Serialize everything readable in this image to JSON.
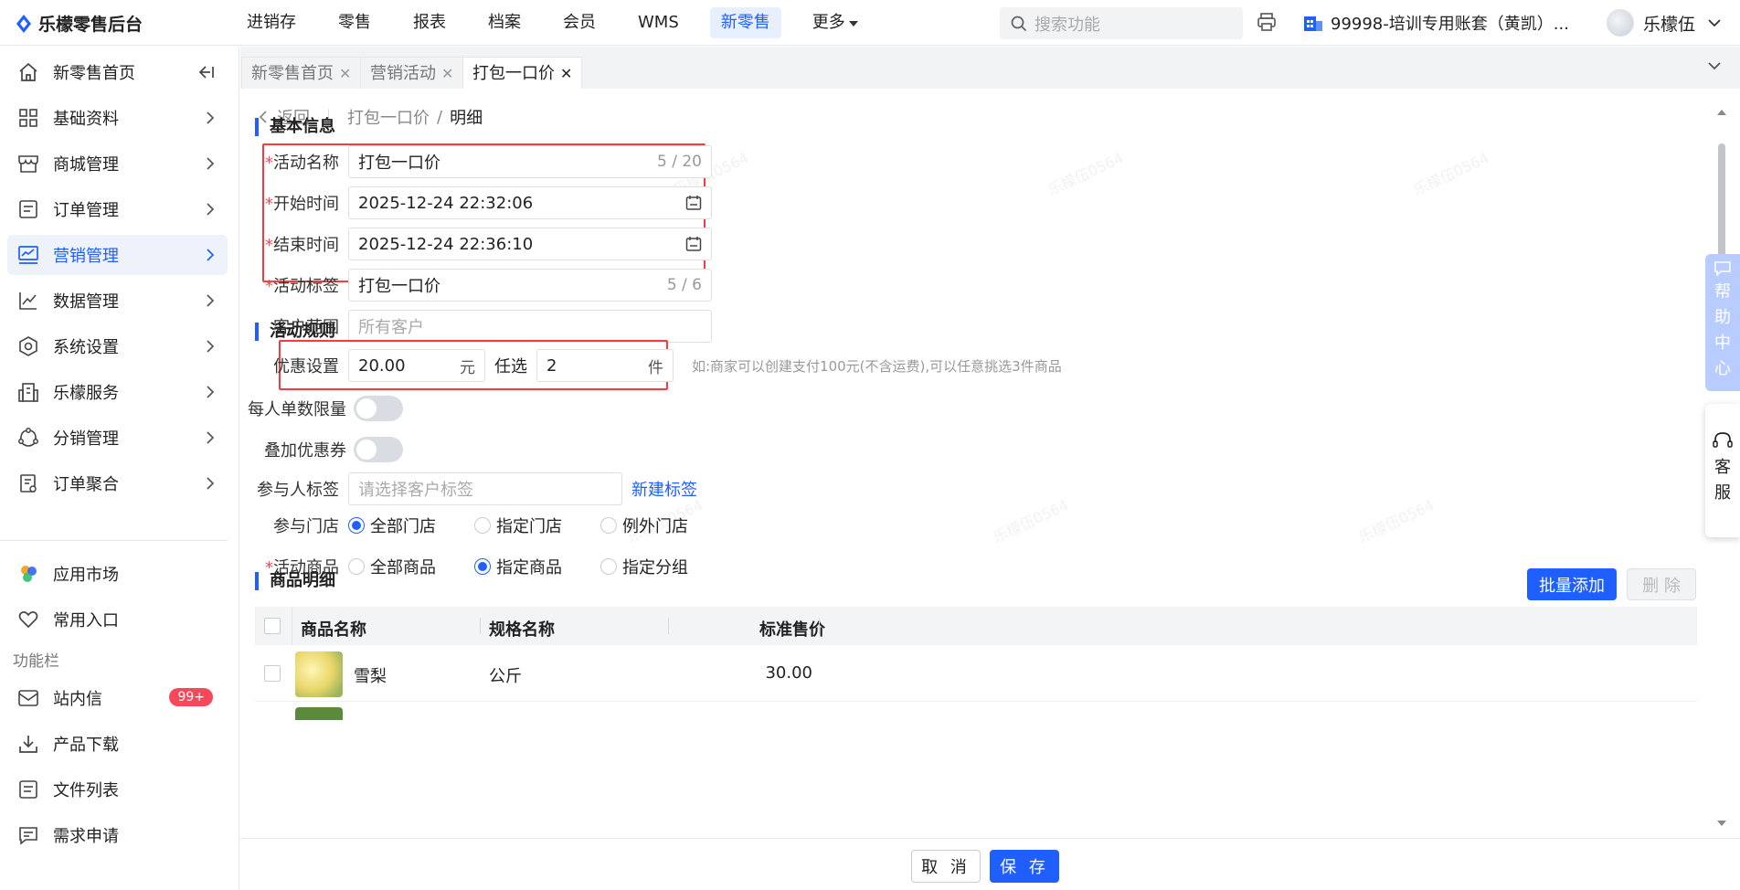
{
  "app": {
    "logo_text": "乐檬零售后台"
  },
  "topnav": {
    "items": [
      "进销存",
      "零售",
      "报表",
      "档案",
      "会员",
      "WMS",
      "新零售",
      "更多"
    ],
    "active": "新零售",
    "search_placeholder": "搜索功能",
    "account": "99998-培训专用账套（黄凯）...",
    "user": "乐檬伍"
  },
  "sidebar": {
    "items": [
      {
        "label": "新零售首页",
        "icon": "home-icon"
      },
      {
        "label": "基础资料",
        "icon": "grid-icon"
      },
      {
        "label": "商城管理",
        "icon": "store-icon"
      },
      {
        "label": "订单管理",
        "icon": "list-icon"
      },
      {
        "label": "营销管理",
        "icon": "monitor-chart-icon"
      },
      {
        "label": "数据管理",
        "icon": "line-chart-icon"
      },
      {
        "label": "系统设置",
        "icon": "settings-icon"
      },
      {
        "label": "乐檬服务",
        "icon": "building-icon"
      },
      {
        "label": "分销管理",
        "icon": "distribution-icon"
      },
      {
        "label": "订单聚合",
        "icon": "document-icon"
      }
    ],
    "active": "营销管理",
    "extra": [
      {
        "label": "应用市场",
        "icon": "app-market-icon"
      },
      {
        "label": "常用入口",
        "icon": "heart-icon"
      }
    ],
    "section_title": "功能栏",
    "tools": [
      {
        "label": "站内信",
        "icon": "mail-icon",
        "badge": "99+"
      },
      {
        "label": "产品下载",
        "icon": "download-icon"
      },
      {
        "label": "文件列表",
        "icon": "file-list-icon"
      },
      {
        "label": "需求申请",
        "icon": "request-icon"
      }
    ]
  },
  "tabs": [
    {
      "label": "新零售首页",
      "active": false
    },
    {
      "label": "营销活动",
      "active": false
    },
    {
      "label": "打包一口价",
      "active": true
    }
  ],
  "breadcrumb": {
    "back": "返回",
    "parent": "打包一口价",
    "current": "明细"
  },
  "basic_info": {
    "title": "基本信息",
    "name_label": "活动名称",
    "name_value": "打包一口价",
    "name_count": "5 / 20",
    "start_label": "开始时间",
    "start_value": "2025-12-24 22:32:06",
    "end_label": "结束时间",
    "end_value": "2025-12-24 22:36:10",
    "tag_label": "活动标签",
    "tag_value": "打包一口价",
    "tag_count": "5 / 6",
    "customer_label": "客户范围",
    "customer_placeholder": "所有客户"
  },
  "rules": {
    "title": "活动规则",
    "discount_label": "优惠设置",
    "price_value": "20.00",
    "price_unit": "元",
    "pick_label": "任选",
    "pick_value": "2",
    "pick_unit": "件",
    "hint": "如:商家可以创建支付100元(不含运费),可以任意挑选3件商品",
    "limit_label": "每人单数限量",
    "coupon_label": "叠加优惠券",
    "tags_label": "参与人标签",
    "tags_placeholder": "请选择客户标签",
    "new_tag": "新建标签",
    "stores_label": "参与门店",
    "stores_options": [
      "全部门店",
      "指定门店",
      "例外门店"
    ],
    "stores_selected": "全部门店",
    "goods_label": "活动商品",
    "goods_options": [
      "全部商品",
      "指定商品",
      "指定分组"
    ],
    "goods_selected": "指定商品"
  },
  "products": {
    "title": "商品明细",
    "batch_add": "批量添加",
    "delete": "删 除",
    "columns": [
      "商品名称",
      "规格名称",
      "标准售价"
    ],
    "rows": [
      {
        "name": "雪梨",
        "spec": "公斤",
        "price": "30.00"
      }
    ]
  },
  "footer": {
    "cancel": "取 消",
    "save": "保 存"
  },
  "float": {
    "help": [
      "帮",
      "助",
      "中",
      "心"
    ],
    "service": [
      "客",
      "服"
    ]
  }
}
